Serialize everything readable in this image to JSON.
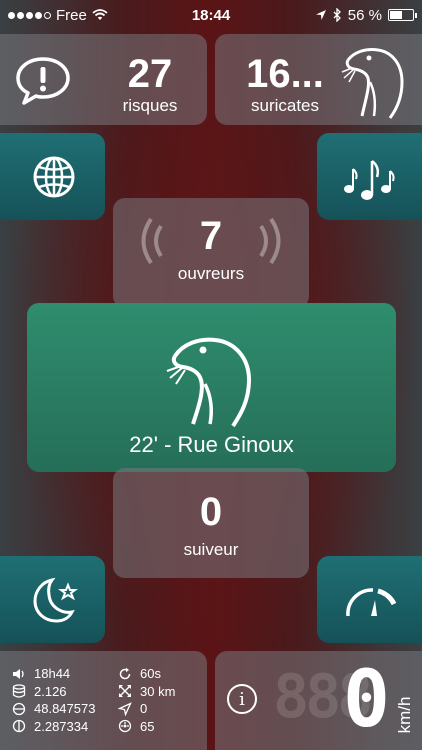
{
  "status_bar": {
    "carrier": "Free",
    "time": "18:44",
    "battery_percent": "56 %",
    "battery_level": 0.56
  },
  "risks": {
    "value": "27",
    "label": "risques"
  },
  "meerkats": {
    "value": "16...",
    "label": "suricates"
  },
  "openers": {
    "value": "7",
    "label": "ouvreurs"
  },
  "current": {
    "text": "22' - Rue Ginoux"
  },
  "followers": {
    "value": "0",
    "label": "suiveur"
  },
  "info": {
    "time": "18h44",
    "data": "2.126",
    "latitude": "48.847573",
    "longitude": "2.287334",
    "refresh": "60s",
    "distance": "30 km",
    "heading": "0",
    "speed_limit": "65"
  },
  "speed": {
    "value": "0",
    "unit": "km/h",
    "ghost": "888"
  },
  "colors": {
    "teal": "#1f6f74",
    "green": "#2f8d6e"
  }
}
